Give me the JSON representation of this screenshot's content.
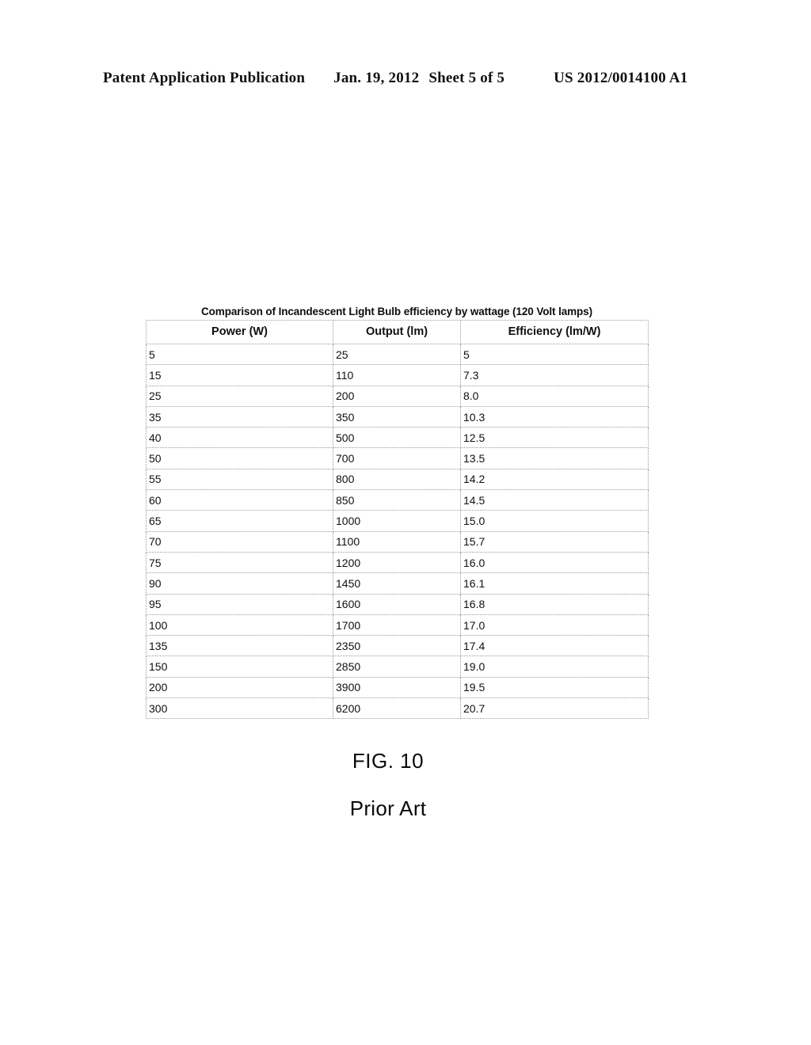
{
  "header": {
    "publication": "Patent Application Publication",
    "date": "Jan. 19, 2012",
    "sheet": "Sheet 5 of 5",
    "publication_number": "US 2012/0014100 A1"
  },
  "figure": {
    "table_title": "Comparison of Incandescent Light Bulb efficiency by wattage (120 Volt lamps)",
    "caption_label": "FIG. 10",
    "caption_sub": "Prior Art"
  },
  "chart_data": {
    "type": "table",
    "title": "Comparison of Incandescent Light Bulb efficiency by wattage (120 Volt lamps)",
    "columns": [
      "Power (W)",
      "Output (lm)",
      "Efficiency (lm/W)"
    ],
    "rows": [
      [
        "5",
        "25",
        "5"
      ],
      [
        "15",
        "110",
        "7.3"
      ],
      [
        "25",
        "200",
        "8.0"
      ],
      [
        "35",
        "350",
        "10.3"
      ],
      [
        "40",
        "500",
        "12.5"
      ],
      [
        "50",
        "700",
        "13.5"
      ],
      [
        "55",
        "800",
        "14.2"
      ],
      [
        "60",
        "850",
        "14.5"
      ],
      [
        "65",
        "1000",
        "15.0"
      ],
      [
        "70",
        "1100",
        "15.7"
      ],
      [
        "75",
        "1200",
        "16.0"
      ],
      [
        "90",
        "1450",
        "16.1"
      ],
      [
        "95",
        "1600",
        "16.8"
      ],
      [
        "100",
        "1700",
        "17.0"
      ],
      [
        "135",
        "2350",
        "17.4"
      ],
      [
        "150",
        "2850",
        "19.0"
      ],
      [
        "200",
        "3900",
        "19.5"
      ],
      [
        "300",
        "6200",
        "20.7"
      ]
    ],
    "xlabel": "Power (W)",
    "ylabel": "Efficiency (lm/W)",
    "series": [
      {
        "name": "Output (lm)",
        "values": [
          25,
          110,
          200,
          350,
          500,
          700,
          800,
          850,
          1000,
          1100,
          1200,
          1450,
          1600,
          1700,
          2350,
          2850,
          3900,
          6200
        ]
      },
      {
        "name": "Efficiency (lm/W)",
        "values": [
          5,
          7.3,
          8.0,
          10.3,
          12.5,
          13.5,
          14.2,
          14.5,
          15.0,
          15.7,
          16.0,
          16.1,
          16.8,
          17.0,
          17.4,
          19.0,
          19.5,
          20.7
        ]
      }
    ],
    "x": [
      5,
      15,
      25,
      35,
      40,
      50,
      55,
      60,
      65,
      70,
      75,
      90,
      95,
      100,
      135,
      150,
      200,
      300
    ]
  }
}
